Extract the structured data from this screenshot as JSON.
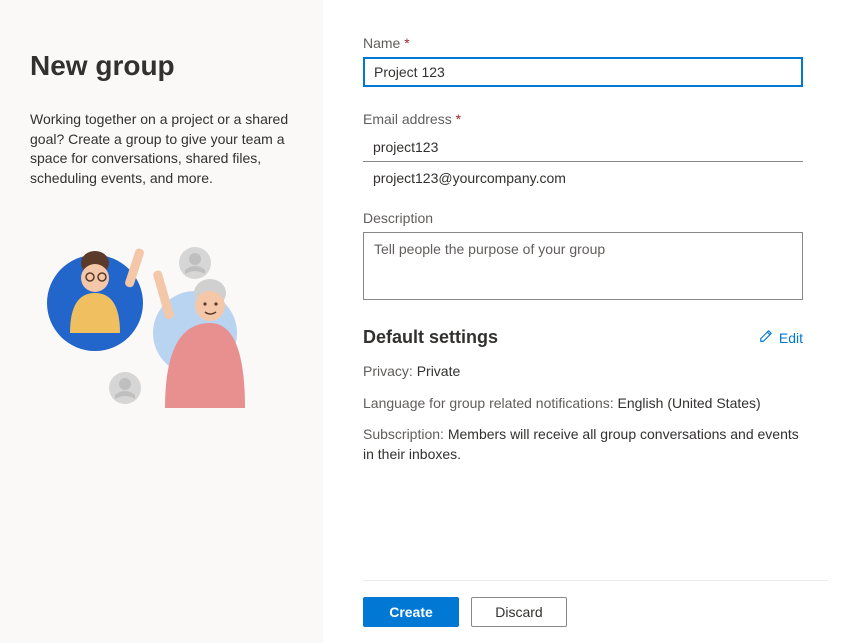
{
  "left": {
    "title": "New group",
    "description": "Working together on a project or a shared goal? Create a group to give your team a space for conversations, shared files, scheduling events, and more."
  },
  "form": {
    "name_label": "Name",
    "name_value": "Project 123",
    "email_label": "Email address",
    "email_value": "project123",
    "email_resolved": "project123@yourcompany.com",
    "desc_label": "Description",
    "desc_placeholder": "Tell people the purpose of your group"
  },
  "settings": {
    "title": "Default settings",
    "edit": "Edit",
    "privacy_label": "Privacy:",
    "privacy_value": "Private",
    "language_label": "Language for group related notifications:",
    "language_value": "English (United States)",
    "subscription_label": "Subscription:",
    "subscription_value": "Members will receive all group conversations and events in their inboxes."
  },
  "footer": {
    "create": "Create",
    "discard": "Discard"
  }
}
